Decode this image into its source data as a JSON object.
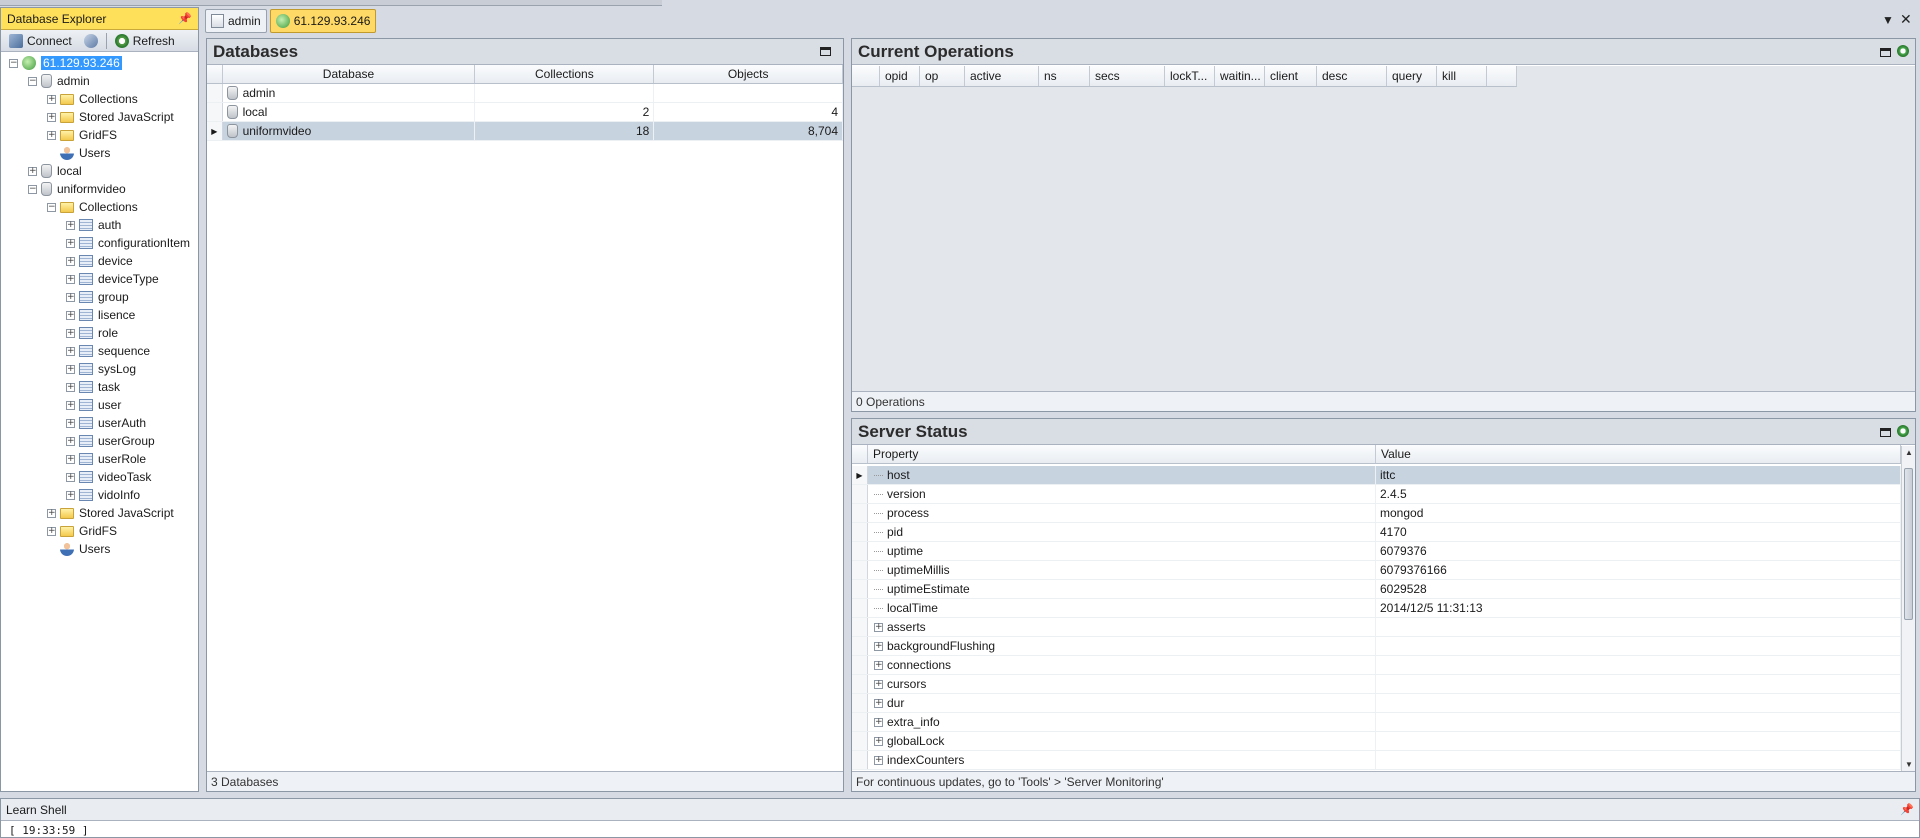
{
  "explorer": {
    "title": "Database Explorer",
    "pin": "⊞",
    "connect_label": "Connect",
    "refresh_label": "Refresh",
    "server": "61.129.93.246",
    "admin_db": "admin",
    "admin_collections": "Collections",
    "admin_stored_js": "Stored JavaScript",
    "admin_gridfs": "GridFS",
    "admin_users": "Users",
    "local_db": "local",
    "uv_db": "uniformvideo",
    "uv_collections_label": "Collections",
    "collections": [
      "auth",
      "configurationItem",
      "device",
      "deviceType",
      "group",
      "lisence",
      "role",
      "sequence",
      "sysLog",
      "task",
      "user",
      "userAuth",
      "userGroup",
      "userRole",
      "videoTask",
      "vidoInfo"
    ],
    "uv_stored_js": "Stored JavaScript",
    "uv_gridfs": "GridFS",
    "uv_users": "Users"
  },
  "tabs": {
    "admin": "admin",
    "server": "61.129.93.246"
  },
  "databases": {
    "title": "Databases",
    "columns": [
      "Database",
      "Collections",
      "Objects"
    ],
    "rows": [
      {
        "name": "admin",
        "collections": "",
        "objects": ""
      },
      {
        "name": "local",
        "collections": "2",
        "objects": "4"
      },
      {
        "name": "uniformvideo",
        "collections": "18",
        "objects": "8,704"
      }
    ],
    "footer": "3 Databases"
  },
  "operations": {
    "title": "Current Operations",
    "columns": [
      "opid",
      "op",
      "active",
      "ns",
      "secs",
      "lockT...",
      "waitin...",
      "client",
      "desc",
      "query",
      "kill"
    ],
    "footer": "0 Operations"
  },
  "server_status": {
    "title": "Server Status",
    "columns": [
      "Property",
      "Value"
    ],
    "rows": [
      {
        "property": "host",
        "value": "ittc"
      },
      {
        "property": "version",
        "value": "2.4.5"
      },
      {
        "property": "process",
        "value": "mongod"
      },
      {
        "property": "pid",
        "value": "4170"
      },
      {
        "property": "uptime",
        "value": "6079376"
      },
      {
        "property": "uptimeMillis",
        "value": "6079376166"
      },
      {
        "property": "uptimeEstimate",
        "value": "6029528"
      },
      {
        "property": "localTime",
        "value": "2014/12/5 11:31:13"
      },
      {
        "property": "asserts",
        "value": ""
      },
      {
        "property": "backgroundFlushing",
        "value": ""
      },
      {
        "property": "connections",
        "value": ""
      },
      {
        "property": "cursors",
        "value": ""
      },
      {
        "property": "dur",
        "value": ""
      },
      {
        "property": "extra_info",
        "value": ""
      },
      {
        "property": "globalLock",
        "value": ""
      },
      {
        "property": "indexCounters",
        "value": ""
      }
    ],
    "footer": "For continuous updates, go to 'Tools' > 'Server Monitoring'"
  },
  "shell": {
    "title": "Learn Shell",
    "line": "[ 19:33:59 ]"
  }
}
